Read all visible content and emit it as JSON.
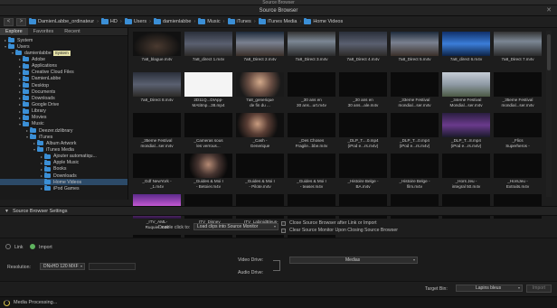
{
  "app": {
    "top_title": "Source Browser",
    "window_title": "Source Browser"
  },
  "path": {
    "back": "<",
    "forward": ">",
    "crumbs": [
      "DamienLabbe_ordinateur",
      "HD",
      "Users",
      "damienlabbe",
      "Music",
      "iTunes",
      "iTunes Media",
      "Home Videos"
    ]
  },
  "tabs": [
    "Explore",
    "Favorites",
    "Recent"
  ],
  "tree": [
    {
      "label": "System",
      "level": 0,
      "arrow": "▸"
    },
    {
      "label": "Users",
      "level": 0,
      "arrow": "▾"
    },
    {
      "label": "damienlabbe",
      "level": 1,
      "arrow": "▾",
      "tooltip": "System"
    },
    {
      "label": "Adobe",
      "level": 2,
      "arrow": "▸"
    },
    {
      "label": "Applications",
      "level": 2,
      "arrow": "▸"
    },
    {
      "label": "Creative Cloud Files",
      "level": 2,
      "arrow": "▸"
    },
    {
      "label": "DamienLabbe",
      "level": 2,
      "arrow": "▸"
    },
    {
      "label": "Desktop",
      "level": 2,
      "arrow": "▸"
    },
    {
      "label": "Documents",
      "level": 2,
      "arrow": "▸"
    },
    {
      "label": "Downloads",
      "level": 2,
      "arrow": "▸"
    },
    {
      "label": "Google Drive",
      "level": 2,
      "arrow": "▸"
    },
    {
      "label": "Library",
      "level": 2,
      "arrow": "▸"
    },
    {
      "label": "Movies",
      "level": 2,
      "arrow": "▸"
    },
    {
      "label": "Music",
      "level": 2,
      "arrow": "▾"
    },
    {
      "label": "Deezer.dzlibrary",
      "level": 3,
      "arrow": "▸"
    },
    {
      "label": "iTunes",
      "level": 3,
      "arrow": "▾"
    },
    {
      "label": "Album Artwork",
      "level": 4,
      "arrow": "▸"
    },
    {
      "label": "iTunes Media",
      "level": 4,
      "arrow": "▾"
    },
    {
      "label": "Ajouter automatiqu...",
      "level": 5,
      "arrow": "▸"
    },
    {
      "label": "Apple Music",
      "level": 5,
      "arrow": "▸"
    },
    {
      "label": "Books",
      "level": 5,
      "arrow": "▸"
    },
    {
      "label": "Downloads",
      "level": 5,
      "arrow": "▸"
    },
    {
      "label": "Home Videos",
      "level": 5,
      "arrow": "",
      "selected": true
    },
    {
      "label": "iPod Games",
      "level": 5,
      "arrow": "▸"
    }
  ],
  "grid": [
    {
      "label": "7a8_blague.m4v",
      "scene": "dark"
    },
    {
      "label": "7a8_direct 1.m4v",
      "scene": "stage"
    },
    {
      "label": "7a8_Direct 2.m4v",
      "scene": "stage2"
    },
    {
      "label": "7a8_Direct 3.m4v",
      "scene": "stage3"
    },
    {
      "label": "7a8_Direct 4.m4v",
      "scene": "stage"
    },
    {
      "label": "7a8_Direct 5.m4v",
      "scene": "stage2"
    },
    {
      "label": "7a8_direct 6.m4v",
      "scene": "blue"
    },
    {
      "label": "7a8_Direct 7.m4v",
      "scene": "stage3"
    },
    {
      "label": "7a8_Direct 8.m4v",
      "scene": "stage"
    },
    {
      "label": "2D11Q...DIApp-\nMAtitmp...38.mp4",
      "scene": "title"
    },
    {
      "label": "7a8_generique\nde fin du ...",
      "scene": "person"
    },
    {
      "label": "_30 ans en\n30 ans...urt.m4v",
      "scene": "black"
    },
    {
      "label": "_30 ans en\n30 ans...ale.m4v",
      "scene": "black"
    },
    {
      "label": "_33eme Festival\nmondial...ser.m4v",
      "scene": "black"
    },
    {
      "label": "_34eme Festival\nMondial...ser.m4v",
      "scene": "house"
    },
    {
      "label": "_35eme Festival\nmondial...ser.m4v",
      "scene": "black"
    },
    {
      "label": "_35eme Festival\nmondial...ser.m4v",
      "scene": "black"
    },
    {
      "label": "_Cameras sous\nles verrous...",
      "scene": "black"
    },
    {
      "label": "_Cash -\nGenerique",
      "scene": "person2"
    },
    {
      "label": "_Des Choses\nFragile...bbe.m4v",
      "scene": "black"
    },
    {
      "label": "_DLP_T....0.mp4\n(iPod e...rs.m4v)",
      "scene": "black"
    },
    {
      "label": "_DLP_T...0.mp4\n(iPod e...rs.m4v)",
      "scene": "black"
    },
    {
      "label": "_DLP_T...8.mp4\n(iPod e...rs.m4v)",
      "scene": "crowd"
    },
    {
      "label": "_Flics\nSuperheros -",
      "scene": "black"
    },
    {
      "label": "_Gdf NewYork -\n_1.m4v",
      "scene": "black"
    },
    {
      "label": "_Guides & Moi I\n- Betoier.m4v",
      "scene": "person3"
    },
    {
      "label": "_Guides & Moi I\n- Pilote.m4v",
      "scene": "black"
    },
    {
      "label": "_Guides & Moi I\n- teaser.m4v",
      "scene": "black"
    },
    {
      "label": "_Histoire Belge -\nBA.m4v",
      "scene": "black"
    },
    {
      "label": "_Histoire Belge -\nfilm.m4v",
      "scene": "black"
    },
    {
      "label": "_Hors Jeu -\nintegral 50.m4v",
      "scene": "black"
    },
    {
      "label": "_HorsJeu -\nExtraits.m4v",
      "scene": "black"
    },
    {
      "label": "_ITV_AML-\nRuquier.m4v",
      "scene": "tv"
    },
    {
      "label": "_ITV_Disney\nClub.m4v",
      "scene": "black"
    },
    {
      "label": "_ITV_LabinidBleus-\nITVMC8.2.m4v",
      "scene": "black"
    },
    {
      "label": "",
      "scene": "black"
    },
    {
      "label": "",
      "scene": "black"
    },
    {
      "label": "",
      "scene": "black"
    },
    {
      "label": "",
      "scene": "black"
    },
    {
      "label": "",
      "scene": "black"
    },
    {
      "label": "",
      "scene": "black"
    },
    {
      "label": "",
      "scene": "black"
    },
    {
      "label": "",
      "scene": "black"
    },
    {
      "label": "",
      "scene": "black"
    }
  ],
  "settings": {
    "header": "Source Browser Settings",
    "double_click_label": "Double click to:",
    "double_click_value": "Load clips into Source Monitor",
    "close_after_link": "Close Source Browser after Link or Import",
    "clear_monitor": "Clear Source Monitor Upon Closing Source Browser",
    "link_label": "Link",
    "import_label": "Import",
    "resolution_label": "Resolution:",
    "resolution_value": "DNxHD 120   MXF",
    "video_drive_label": "Video Drive:",
    "audio_drive_label": "Audio Drive:",
    "drive_value": "Medias",
    "target_bin_label": "Target Bin:",
    "target_bin_value": "Lapins bleus",
    "import_button": "Import"
  },
  "status": {
    "text": "Media Processing..."
  },
  "colors": {
    "accent": "#3b8fd6",
    "selection": "#2c4a68",
    "radio_on": "#5fb35f"
  }
}
